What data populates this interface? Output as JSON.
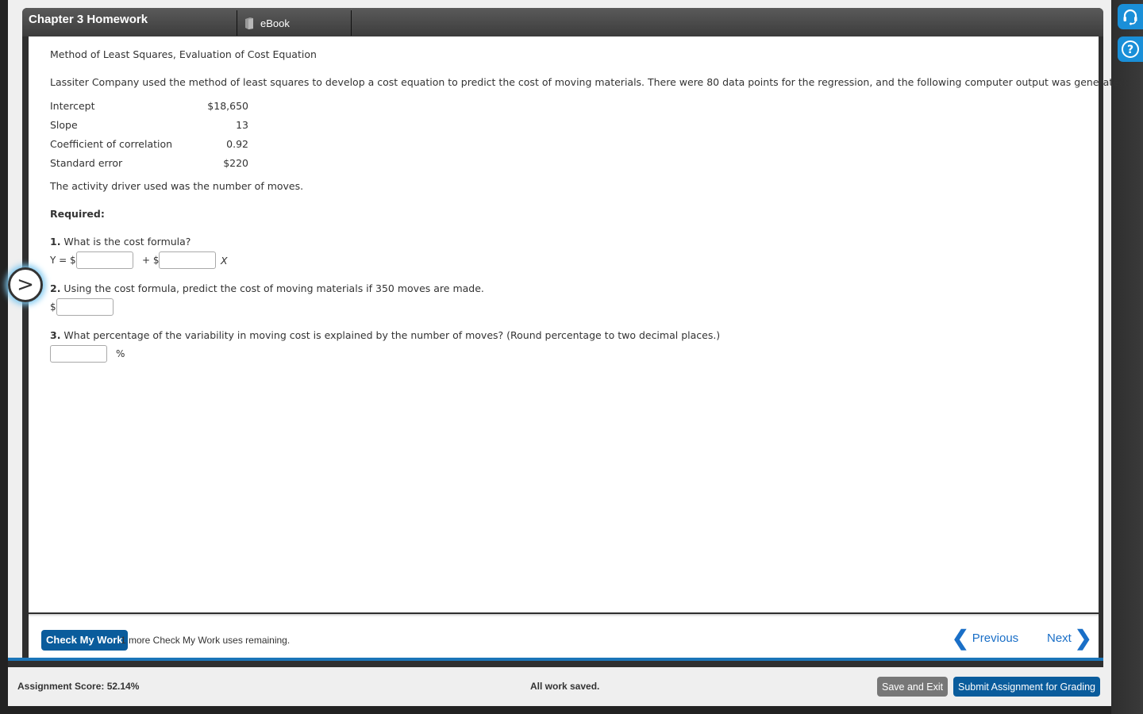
{
  "window": {
    "title": "Chapter 3 Homework",
    "ebook_tab": "eBook"
  },
  "problem": {
    "heading": "Method of Least Squares, Evaluation of Cost Equation",
    "intro": "Lassiter Company used the method of least squares to develop a cost equation to predict the cost of moving materials. There were 80 data points for the regression, and the following computer output was generated:",
    "output_table": [
      {
        "label": "Intercept",
        "value": "$18,650"
      },
      {
        "label": "Slope",
        "value": "13"
      },
      {
        "label": "Coefficient of correlation",
        "value": "0.92"
      },
      {
        "label": "Standard error",
        "value": "$220"
      }
    ],
    "driver_note": "The activity driver used was the number of moves.",
    "required_label": "Required:",
    "q1": {
      "number": "1.",
      "text": " What is the cost formula?",
      "prefix": "Y = $",
      "middle": "+ $",
      "suffix": "X",
      "intercept_value": "",
      "slope_value": ""
    },
    "q2": {
      "number": "2.",
      "text": " Using the cost formula, predict the cost of moving materials if 350 moves are made.",
      "prefix": "$",
      "value": ""
    },
    "q3": {
      "number": "3.",
      "text": " What percentage of the variability in moving cost is explained by the number of moves? (Round percentage to two decimal places.)",
      "suffix": "%",
      "value": ""
    }
  },
  "footer": {
    "check_button": "Check My Work",
    "remaining_text": "1 more Check My Work uses remaining.",
    "previous": "Previous",
    "next": "Next"
  },
  "bottom": {
    "score": "Assignment Score: 52.14%",
    "status": "All work saved.",
    "save_exit": "Save and Exit",
    "submit": "Submit Assignment for Grading"
  },
  "icons": {
    "side_arrow": ">",
    "chevron_left": "❮",
    "chevron_right": "❯",
    "help": "?"
  },
  "colors": {
    "accent": "#0a5c9c",
    "link": "#1a6fc7",
    "rail_button": "#1a8fd8"
  }
}
